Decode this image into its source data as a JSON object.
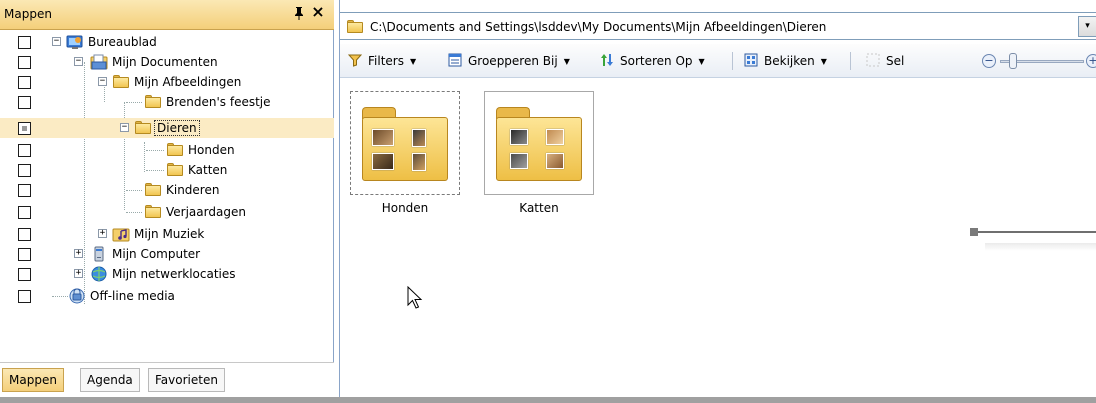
{
  "left_pane": {
    "title": "Mappen",
    "pin_glyph": "ᵖ",
    "close_glyph": "×",
    "tree": [
      {
        "label": "Bureaublad",
        "icon": "desktop-icon",
        "expander": "⊟"
      },
      {
        "label": "Mijn Documenten",
        "icon": "documents-icon",
        "expander": "⊟"
      },
      {
        "label": "Mijn Afbeeldingen",
        "icon": "folder-icon",
        "expander": "⊟"
      },
      {
        "label": "Brenden's feestje",
        "icon": "folder-icon"
      },
      {
        "label": "Dieren",
        "icon": "folder-icon",
        "expander": "⊟",
        "selected": true,
        "checkbox": "mixed"
      },
      {
        "label": "Honden",
        "icon": "folder-icon"
      },
      {
        "label": "Katten",
        "icon": "folder-icon"
      },
      {
        "label": "Kinderen",
        "icon": "folder-icon"
      },
      {
        "label": "Verjaardagen",
        "icon": "folder-icon"
      },
      {
        "label": "Mijn Muziek",
        "icon": "music-folder-icon",
        "expander": "⊞"
      },
      {
        "label": "Mijn Computer",
        "icon": "computer-icon",
        "expander": "⊞"
      },
      {
        "label": "Mijn netwerklocaties",
        "icon": "network-icon",
        "expander": "⊞"
      },
      {
        "label": "Off-line media",
        "icon": "offline-media-icon"
      }
    ],
    "tabs": [
      {
        "label": "Mappen",
        "active": true
      },
      {
        "label": "Agenda"
      },
      {
        "label": "Favorieten"
      }
    ]
  },
  "address": {
    "path": "C:\\Documents and Settings\\lsddev\\My Documents\\Mijn Afbeeldingen\\Dieren",
    "dropdown_glyph": "▾"
  },
  "toolbar": {
    "filters": "Filters",
    "group": "Groepperen Bij",
    "sort": "Sorteren Op",
    "view": "Bekijken",
    "select": "Sel",
    "arrow": "▼",
    "zoom_minus": "−",
    "zoom_plus": "+"
  },
  "items": [
    {
      "label": "Honden",
      "focused": true
    },
    {
      "label": "Katten",
      "selected": true
    }
  ],
  "colors": {
    "header_gradient_top": "#fbe8b4",
    "header_gradient_bottom": "#f4cf7a",
    "selection_bg": "#fbebc4",
    "border_blue": "#7f9db9"
  }
}
